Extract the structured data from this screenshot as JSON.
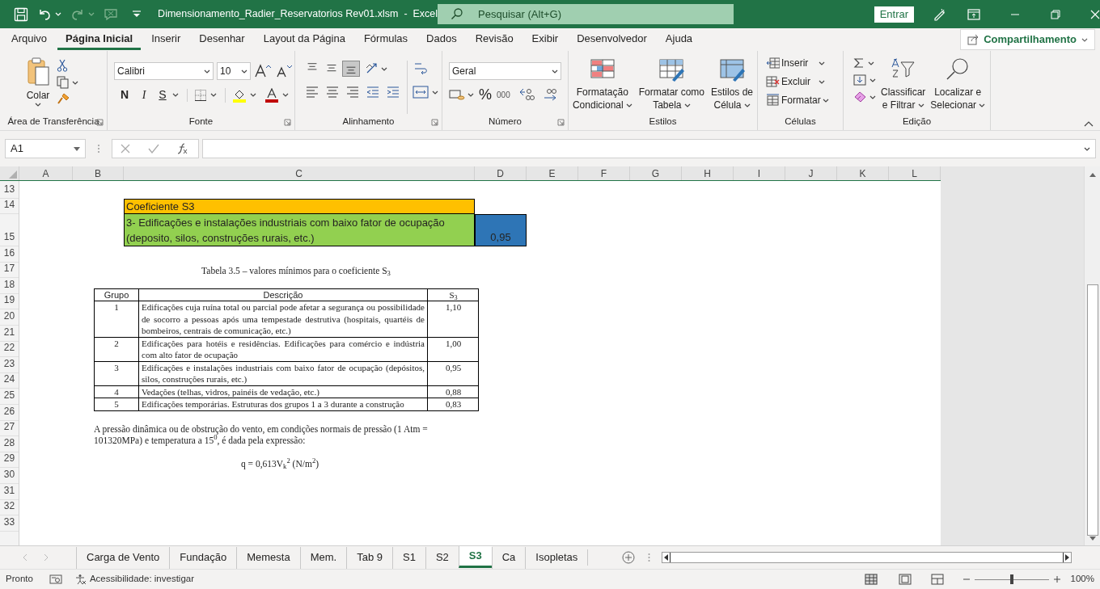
{
  "title_bar": {
    "title": "Dimensionamento_Radier_Reservatorios Rev01.xlsm  -  Excel",
    "search": {
      "placeholder": "Pesquisar (Alt+G)"
    },
    "sign_in": "Entrar"
  },
  "ribbon_tabs": [
    {
      "label": "Arquivo",
      "selected": false
    },
    {
      "label": "Página Inicial",
      "selected": true
    },
    {
      "label": "Inserir",
      "selected": false
    },
    {
      "label": "Desenhar",
      "selected": false
    },
    {
      "label": "Layout da Página",
      "selected": false
    },
    {
      "label": "Fórmulas",
      "selected": false
    },
    {
      "label": "Dados",
      "selected": false
    },
    {
      "label": "Revisão",
      "selected": false
    },
    {
      "label": "Exibir",
      "selected": false
    },
    {
      "label": "Desenvolvedor",
      "selected": false
    },
    {
      "label": "Ajuda",
      "selected": false
    }
  ],
  "share_button": "Compartilhamento",
  "ribbon": {
    "clipboard": {
      "paste": "Colar",
      "label": "Área de Transferência"
    },
    "font": {
      "font_name": "Calibri",
      "font_size": "10",
      "bold": "N",
      "italic": "I",
      "underline": "S",
      "label": "Fonte"
    },
    "alignment": {
      "vertical_align": [
        {
          "selected": false
        },
        {
          "selected": false
        },
        {
          "selected": true
        }
      ],
      "label": "Alinhamento"
    },
    "number": {
      "format": "Geral",
      "percent": "%",
      "thousands": "000",
      "label": "Número"
    },
    "styles": {
      "buttons": [
        {
          "lines": [
            "Formatação",
            "Condicional"
          ]
        },
        {
          "lines": [
            "Formatar como",
            "Tabela"
          ]
        },
        {
          "lines": [
            "Estilos de",
            "Célula"
          ]
        }
      ],
      "label": "Estilos"
    },
    "cells": {
      "buttons": [
        "Inserir",
        "Excluir",
        "Formatar"
      ],
      "label": "Células"
    },
    "editing": {
      "buttons": [
        {
          "lines": [
            "Classificar",
            "e Filtrar"
          ]
        },
        {
          "lines": [
            "Localizar e",
            "Selecionar"
          ]
        }
      ],
      "label": "Edição"
    }
  },
  "formula_bar": {
    "name_box": "A1"
  },
  "sheet": {
    "columns": [
      "A",
      "B",
      "C",
      "D",
      "E",
      "F",
      "G",
      "H",
      "I",
      "J",
      "K",
      "L"
    ],
    "rows": [
      "13",
      "14",
      "15",
      "16",
      "17",
      "18",
      "19",
      "20",
      "21",
      "22",
      "23",
      "24",
      "25",
      "26",
      "27",
      "28",
      "29",
      "30",
      "31",
      "32",
      "33"
    ],
    "cells": [
      {
        "kind": "header",
        "text": "Coeficiente S3"
      },
      {
        "kind": "description",
        "text": "3- Edificações e instalações industriais com baixo fator de ocupação (deposito, silos, construções rurais, etc.)"
      },
      {
        "kind": "value",
        "text": "0,95"
      }
    ]
  },
  "embedded_document": {
    "title": "Tabela 3.5 – valores mínimos para o coeficiente S$_{3}$",
    "columns": [
      "Grupo",
      "Descrição",
      "S$_{3}$"
    ],
    "rows": [
      {
        "group": "1",
        "description": "Edificações cuja ruína total ou parcial pode afetar a segurança ou possibilidade de socorro a pessoas após uma tempestade destrutiva (hospitais, quartéis de bombeiros, centrais de comunicação, etc.)",
        "value": "1,10"
      },
      {
        "group": "2",
        "description": "Edificações para hotéis e residências. Edificações para comércio e indústria com alto fator de ocupação",
        "value": "1,00"
      },
      {
        "group": "3",
        "description": "Edificações e instalações industriais com baixo fator de ocupação (depósitos, silos, construções rurais, etc.)",
        "value": "0,95"
      },
      {
        "group": "4",
        "description": "Vedações (telhas, vidros, painéis de vedação, etc.)",
        "value": "0,88"
      },
      {
        "group": "5",
        "description": "Edificações temporárias. Estruturas dos grupos 1 a 3 durante a construção",
        "value": "0,83"
      }
    ],
    "paragraph": "A pressão dinâmica ou de obstrução do vento, em condições normais de pressão (1 Atm = 101320MPa) e temperatura a 15$^{0}$, é dada pela expressão:",
    "formula": "q = 0,613V$_{k}$$^{2}$ (N/m$^{2}$)"
  },
  "sheet_tabs": [
    {
      "label": "Carga de Vento",
      "selected": false
    },
    {
      "label": "Fundação",
      "selected": false
    },
    {
      "label": "Memesta",
      "selected": false
    },
    {
      "label": "Mem.",
      "selected": false
    },
    {
      "label": "Tab 9",
      "selected": false
    },
    {
      "label": "S1",
      "selected": false
    },
    {
      "label": "S2",
      "selected": false
    },
    {
      "label": "S3",
      "selected": true
    },
    {
      "label": "Ca",
      "selected": false
    },
    {
      "label": "Isopletas",
      "selected": false
    }
  ],
  "status_bar": {
    "mode": "Pronto",
    "accessibility": "Acessibilidade: investigar",
    "zoom": {
      "level": 0.5,
      "reading": "100%"
    }
  }
}
